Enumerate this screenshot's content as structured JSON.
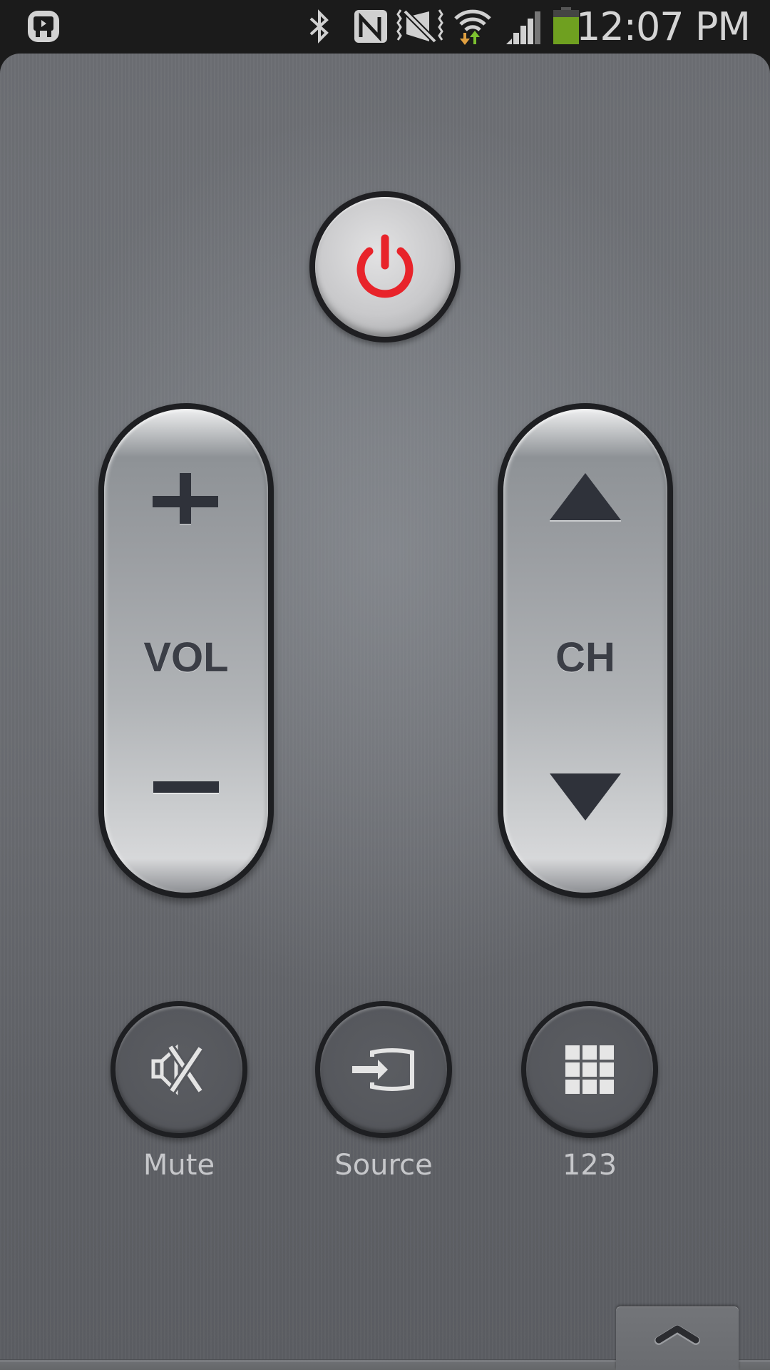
{
  "status_bar": {
    "time": "12:07 PM",
    "icons": [
      "smart-remote-app-icon",
      "bluetooth-icon",
      "nfc-icon",
      "vibrate-off-icon",
      "wifi-icon",
      "signal-icon",
      "battery-icon"
    ],
    "colors": {
      "battery": "#6fa020",
      "wifi_down": "#e0a040",
      "wifi_up": "#7cc030",
      "icon": "#d0d0d0"
    }
  },
  "remote": {
    "power": {
      "icon": "power-icon",
      "color": "#e8232a"
    },
    "volume": {
      "label": "VOL",
      "up_icon": "plus-icon",
      "down_icon": "minus-icon"
    },
    "channel": {
      "label": "CH",
      "up_icon": "triangle-up-icon",
      "down_icon": "triangle-down-icon"
    },
    "buttons": [
      {
        "id": "mute",
        "label": "Mute",
        "icon": "mute-icon"
      },
      {
        "id": "source",
        "label": "Source",
        "icon": "source-input-icon"
      },
      {
        "id": "keypad",
        "label": "123",
        "icon": "keypad-grid-icon"
      }
    ],
    "drawer": {
      "icon": "chevron-up-icon"
    }
  }
}
